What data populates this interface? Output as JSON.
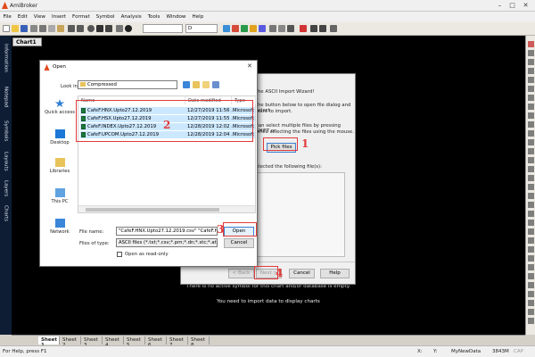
{
  "app": {
    "title": "AmiBroker"
  },
  "menu": [
    "File",
    "Edit",
    "View",
    "Insert",
    "Format",
    "Symbol",
    "Analysis",
    "Tools",
    "Window",
    "Help"
  ],
  "toolbar": {
    "interval_value": "",
    "symbol_value": "D"
  },
  "left_tabs": [
    "Information",
    "Notepad",
    "Symbols",
    "Layouts",
    "Layers",
    "Charts"
  ],
  "chart": {
    "tab_label": "Chart1",
    "message1": "There is no active symbol for this chart and/or database is empty.",
    "message2": "You need to import data to display charts"
  },
  "sheets": [
    "Sheet 1",
    "Sheet 2",
    "Sheet 3",
    "Sheet 4",
    "Sheet 5",
    "Sheet 6",
    "Sheet 7",
    "Sheet 8"
  ],
  "status": {
    "left": "For Help, press F1",
    "x": "X:",
    "y": "Y:",
    "db": "MyNewData",
    "mem": "3843M",
    "cap": "CAP"
  },
  "wizard": {
    "title_suffix": "the ASCII Import Wizard!",
    "instr1": "the button below to open file dialog and select",
    "instr2": "want to import.",
    "instr3": "can select multiple files by pressing SHIFT or",
    "instr4": "while selecting the files using the mouse.",
    "pick_files": "Pick files",
    "selected_label": "elected the following file(s):",
    "back": "< Back",
    "next": "Next >",
    "cancel": "Cancel",
    "help": "Help"
  },
  "open_dialog": {
    "title": "Open",
    "look_in_label": "Look in:",
    "look_in_value": "Compressed",
    "columns": {
      "name": "Name",
      "date": "Date modified",
      "type": "Type"
    },
    "files": [
      {
        "name": "CafeF.HNX.Upto27.12.2019",
        "date": "12/27/2019 11:56 ...",
        "type": "Microsoft"
      },
      {
        "name": "CafeF.HSX.Upto27.12.2019",
        "date": "12/27/2019 11:55 ...",
        "type": "Microsoft"
      },
      {
        "name": "CafeF.INDEX.Upto27.12.2019",
        "date": "12/28/2019 12:02 ...",
        "type": "Microsoft"
      },
      {
        "name": "CafeF.UPCOM.Upto27.12.2019",
        "date": "12/28/2019 12:04 ...",
        "type": "Microsoft"
      }
    ],
    "places": [
      "Quick access",
      "Desktop",
      "Libraries",
      "This PC",
      "Network"
    ],
    "file_name_label": "File name:",
    "file_name_value": "\"CafeF.HNX.Upto27.12.2019.csv\" \"CafeF.HSX",
    "file_type_label": "Files of type:",
    "file_type_value": "ASCII files (*.txt;*.csv;*.prn;*.dn;*.stc;*.atk)",
    "read_only_label": "Open as read-only",
    "open_button": "Open",
    "cancel_button": "Cancel"
  },
  "annotations": [
    "1",
    "2",
    "3",
    "4"
  ]
}
